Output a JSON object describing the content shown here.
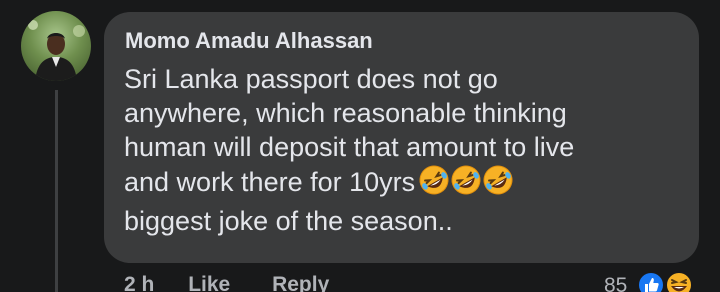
{
  "comment": {
    "author": "Momo Amadu Alhassan",
    "lines": [
      "Sri Lanka passport does not go",
      "anywhere, which reasonable thinking",
      "human will deposit that amount to live",
      "and work there for 10yrs",
      "biggest joke of the season.."
    ],
    "emoji_after_line_4": [
      "rolling-on-floor-laughing-emoji",
      "rolling-on-floor-laughing-emoji",
      "rolling-on-floor-laughing-emoji"
    ]
  },
  "actions": {
    "time": "2 h",
    "like_label": "Like",
    "reply_label": "Reply"
  },
  "reactions": {
    "count": "85",
    "icons": [
      "like-reaction-icon",
      "haha-reaction-icon"
    ]
  },
  "colors": {
    "background": "#18191a",
    "bubble": "#3a3b3c",
    "text": "#e4e6eb",
    "muted": "#b0b3b8",
    "like_blue": "#1877f2",
    "emoji_yellow": "#f7b125"
  }
}
